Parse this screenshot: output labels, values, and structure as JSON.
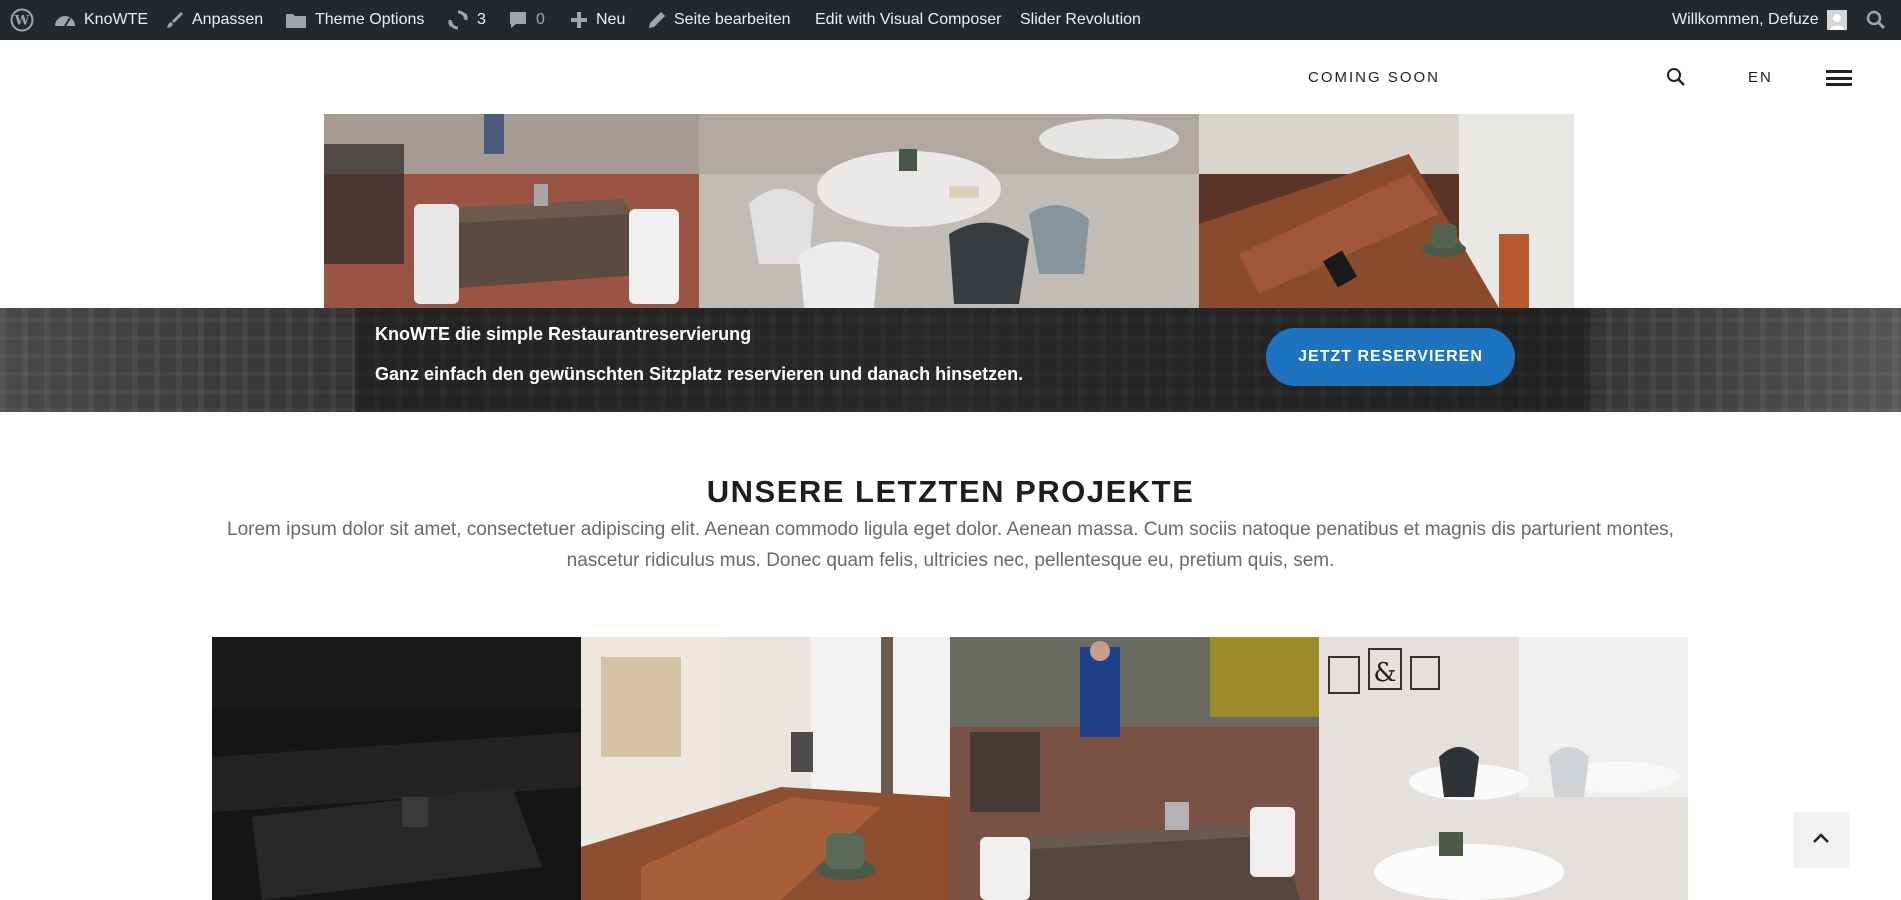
{
  "adminbar": {
    "site_name": "KnoWTE",
    "customize": "Anpassen",
    "theme_options": "Theme Options",
    "updates_count": "3",
    "comments_count": "0",
    "new_label": "Neu",
    "edit_page": "Seite bearbeiten",
    "visual_composer": "Edit with Visual Composer",
    "slider_revolution": "Slider Revolution",
    "welcome": "Willkommen, Defuze"
  },
  "header": {
    "nav_coming_soon": "COMING SOON",
    "lang": "EN"
  },
  "cta": {
    "title": "KnoWTE die simple Restaurantreservierung",
    "subtitle": "Ganz einfach den gewünschten Sitzplatz reservieren und danach hinsetzen.",
    "button": "JETZT RESERVIEREN",
    "button_color": "#1e73be"
  },
  "projects": {
    "title": "UNSERE LETZTEN PROJEKTE",
    "text": "Lorem ipsum dolor sit amet, consectetuer adipiscing elit. Aenean commodo ligula eget dolor. Aenean massa. Cum sociis natoque penatibus et magnis dis parturient montes, nascetur ridiculus mus. Donec quam felis, ultricies nec, pellentesque eu, pretium quis, sem."
  },
  "colors": {
    "adminbar_bg": "#23282d",
    "heading": "#1e1e1e",
    "body_text": "#6a6a6a"
  }
}
